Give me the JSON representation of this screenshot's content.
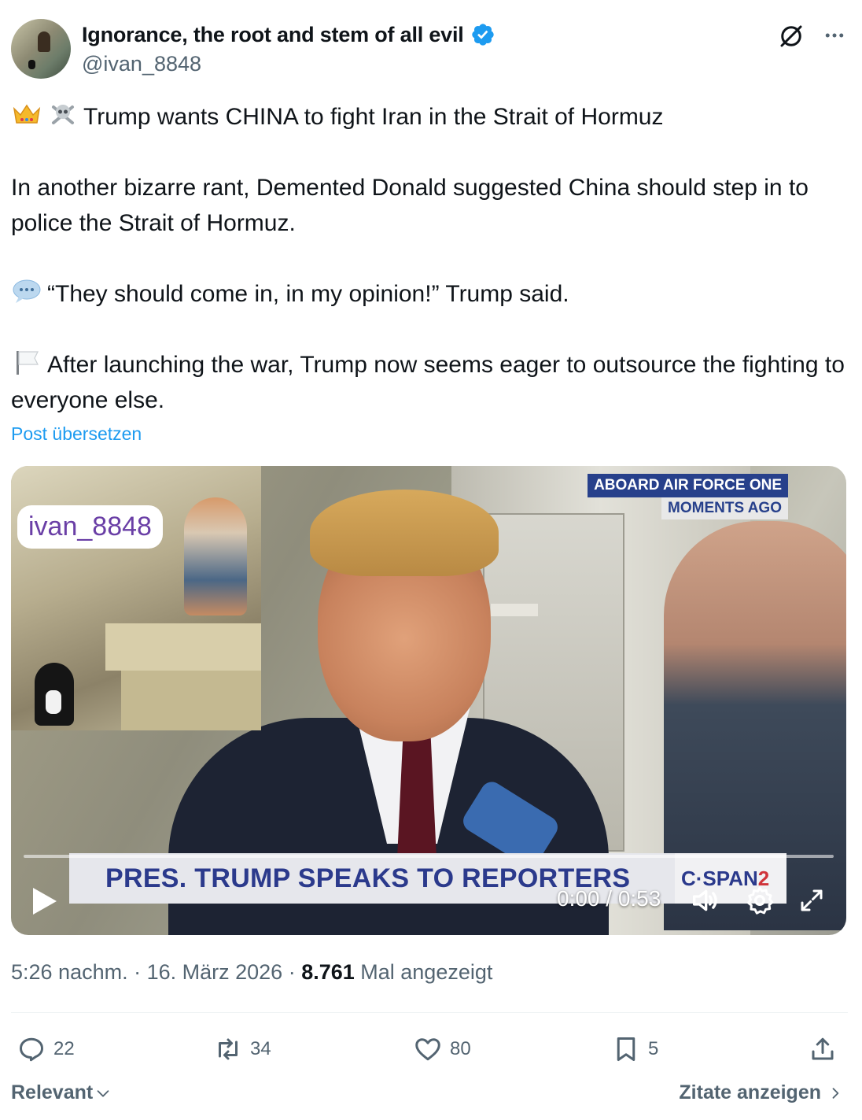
{
  "author": {
    "display_name": "Ignorance, the root and stem of all evil",
    "handle": "@ivan_8848",
    "verified": true
  },
  "post": {
    "line1": "Trump wants CHINA to fight Iran in the Strait of Hormuz",
    "line1_icons": [
      "crown-icon",
      "skull-crossbones-icon"
    ],
    "line2": "In another bizarre rant, Demented Donald suggested China should step in to police the Strait of Hormuz.",
    "line3": "“They should come in, in my opinion!” Trump said.",
    "line3_icon": "speech-bubble-icon",
    "line4": "After launching the war, Trump now seems eager to outsource the fighting to everyone else.",
    "line4_icon": "white-flag-icon",
    "translate_label": "Post übersetzen"
  },
  "media": {
    "watermark": "ivan_8848",
    "chyron_line1": "ABOARD AIR FORCE ONE",
    "chyron_line2": "MOMENTS AGO",
    "lower_third": "PRES. TRUMP SPEAKS TO REPORTERS",
    "network_prefix": "C·SPAN",
    "network_suffix": "2",
    "time": "0:00 / 0:53",
    "progress": 0
  },
  "meta": {
    "time_date": "5:26 nachm. · 16. März 2026 · ",
    "views": "8.761",
    "views_label": " Mal angezeigt"
  },
  "actions": {
    "replies": "22",
    "reposts": "34",
    "likes": "80",
    "bookmarks": "5"
  },
  "footer": {
    "sort_label": "Relevant",
    "quotes_label": "Zitate anzeigen"
  },
  "colors": {
    "accent": "#1d9bf0",
    "secondary_text": "#536471",
    "chyron_blue": "#27408b",
    "cspan_red": "#d0343a"
  }
}
